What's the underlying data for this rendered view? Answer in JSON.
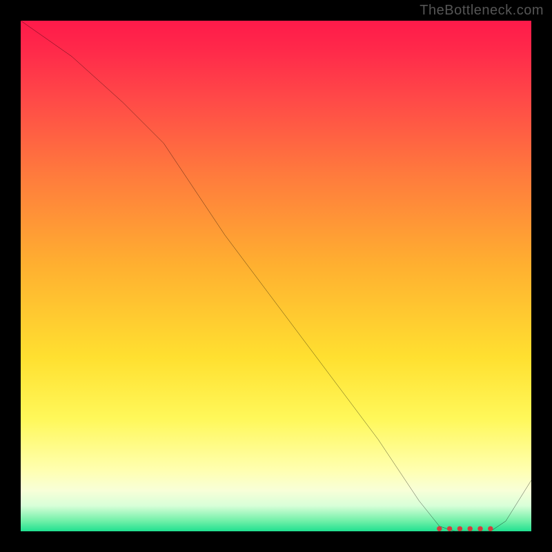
{
  "watermark": "TheBottleneck.com",
  "chart_data": {
    "type": "line",
    "title": "",
    "xlabel": "",
    "ylabel": "",
    "xlim": [
      0,
      100
    ],
    "ylim": [
      0,
      100
    ],
    "series": [
      {
        "name": "curve",
        "x": [
          0,
          10,
          20,
          28,
          40,
          55,
          70,
          78,
          82,
          85,
          88,
          92,
          95,
          100
        ],
        "values": [
          100,
          93,
          84,
          76,
          58,
          38,
          18,
          6,
          1,
          0,
          0,
          0,
          2,
          10
        ]
      }
    ],
    "markers": {
      "name": "flat-region",
      "x": [
        82,
        84,
        86,
        88,
        90,
        92
      ],
      "values": [
        0.5,
        0.5,
        0.5,
        0.5,
        0.5,
        0.5
      ]
    },
    "background_gradient": {
      "stops": [
        {
          "pos": 0.0,
          "color": "#ff1a4a"
        },
        {
          "pos": 0.06,
          "color": "#ff2a4a"
        },
        {
          "pos": 0.15,
          "color": "#ff4848"
        },
        {
          "pos": 0.3,
          "color": "#ff7a3d"
        },
        {
          "pos": 0.48,
          "color": "#ffb030"
        },
        {
          "pos": 0.66,
          "color": "#ffe030"
        },
        {
          "pos": 0.78,
          "color": "#fff85a"
        },
        {
          "pos": 0.88,
          "color": "#ffffb0"
        },
        {
          "pos": 0.92,
          "color": "#f8ffd8"
        },
        {
          "pos": 0.95,
          "color": "#d8ffd8"
        },
        {
          "pos": 0.98,
          "color": "#70f0a8"
        },
        {
          "pos": 1.0,
          "color": "#20e090"
        }
      ]
    }
  }
}
